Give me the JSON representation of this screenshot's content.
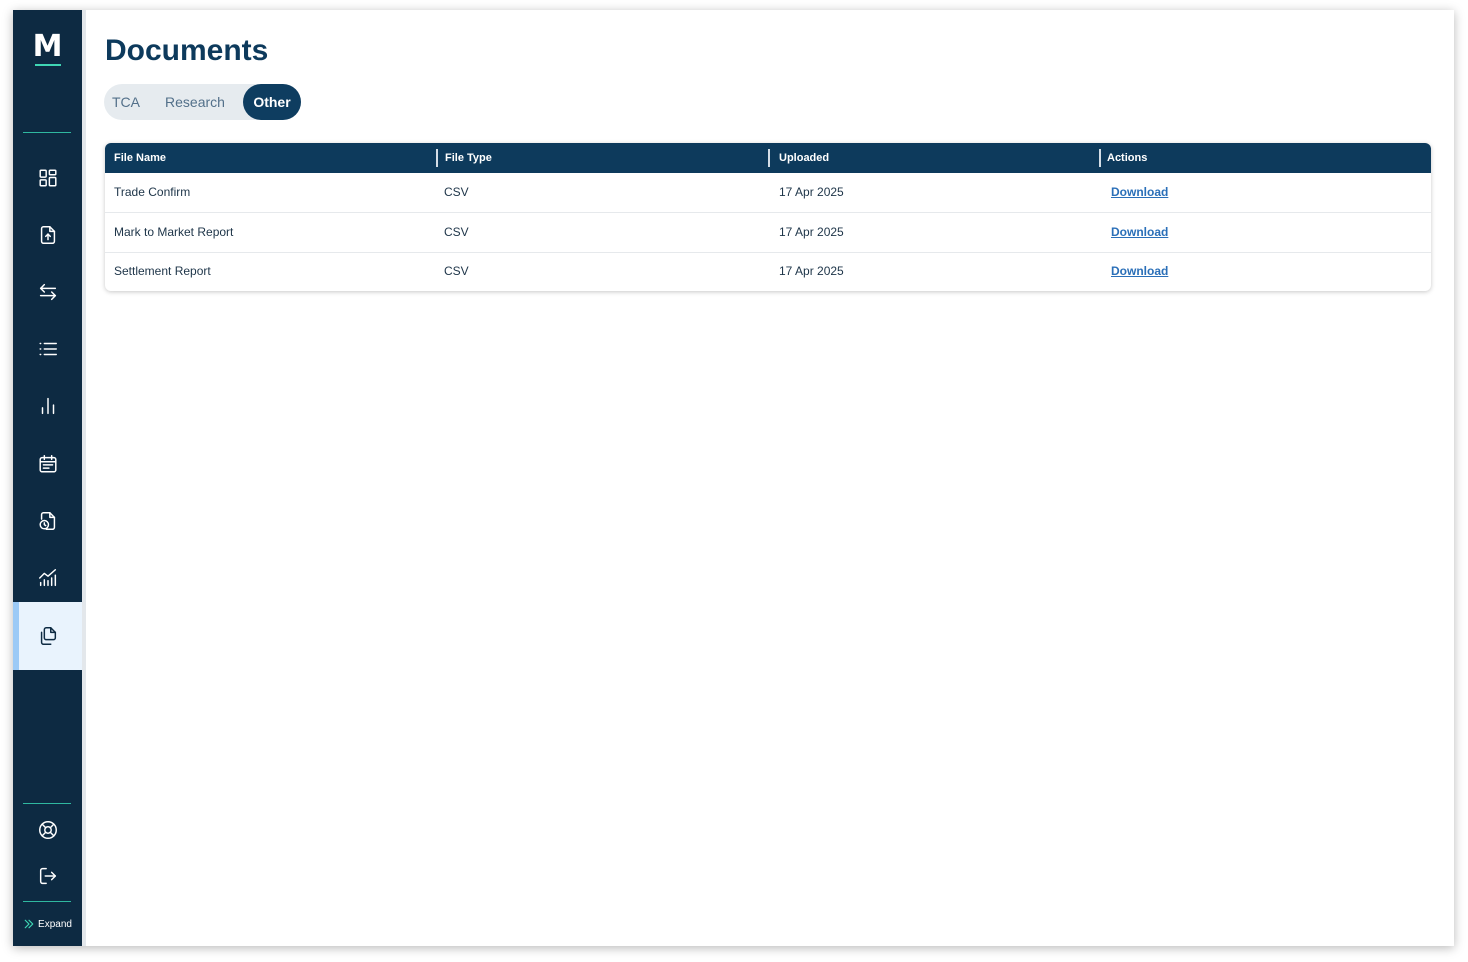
{
  "brand": {
    "logo_letter": "M",
    "accent_color": "#3fd6b4",
    "sidebar_color": "#0d2a42",
    "primary_color": "#0d3a5c",
    "link_color": "#2a6fb8"
  },
  "sidebar": {
    "items": [
      {
        "icon": "dashboard-grid-icon",
        "active": false
      },
      {
        "icon": "file-upload-icon",
        "active": false
      },
      {
        "icon": "transfer-arrows-icon",
        "active": false
      },
      {
        "icon": "list-icon",
        "active": false
      },
      {
        "icon": "bar-chart-icon",
        "active": false
      },
      {
        "icon": "calendar-icon",
        "active": false
      },
      {
        "icon": "file-clock-icon",
        "active": false
      },
      {
        "icon": "trend-chart-icon",
        "active": false
      },
      {
        "icon": "documents-copy-icon",
        "active": true
      }
    ],
    "bottom_items": [
      {
        "icon": "lifebuoy-support-icon"
      },
      {
        "icon": "logout-icon"
      }
    ],
    "expand_label": "Expand"
  },
  "page": {
    "title": "Documents"
  },
  "tabs": [
    {
      "label": "TCA",
      "active": false
    },
    {
      "label": "Research",
      "active": false
    },
    {
      "label": "Other",
      "active": true
    }
  ],
  "table": {
    "columns": [
      "File Name",
      "File Type",
      "Uploaded",
      "Actions"
    ],
    "rows": [
      {
        "file_name": "Trade Confirm",
        "file_type": "CSV",
        "uploaded": "17 Apr 2025",
        "action": "Download"
      },
      {
        "file_name": "Mark to Market Report",
        "file_type": "CSV",
        "uploaded": "17 Apr 2025",
        "action": "Download"
      },
      {
        "file_name": "Settlement Report",
        "file_type": "CSV",
        "uploaded": "17 Apr 2025",
        "action": "Download"
      }
    ]
  }
}
